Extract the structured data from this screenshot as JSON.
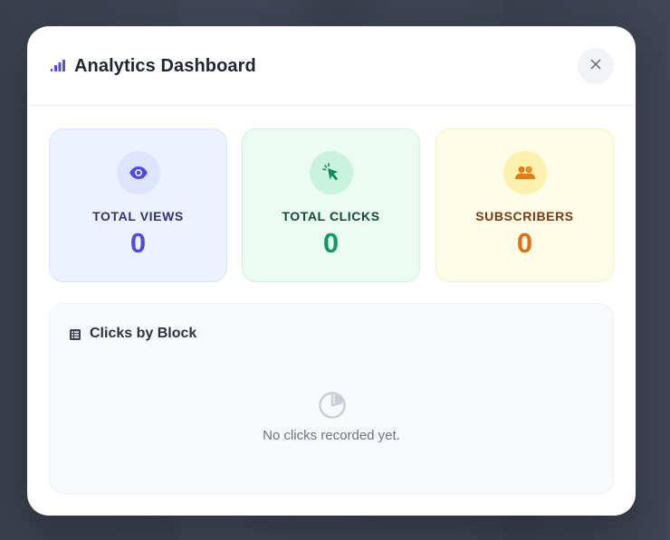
{
  "modal": {
    "title": "Analytics Dashboard",
    "close_icon": "close-icon",
    "title_icon": "bar-chart-icon"
  },
  "stats": {
    "views": {
      "label": "TOTAL VIEWS",
      "value": "0",
      "icon": "eye-icon",
      "accent": "#5349e6"
    },
    "clicks": {
      "label": "TOTAL CLICKS",
      "value": "0",
      "icon": "cursor-click-icon",
      "accent": "#0f9a64"
    },
    "subscribers": {
      "label": "SUBSCRIBERS",
      "value": "0",
      "icon": "users-icon",
      "accent": "#e07010"
    }
  },
  "clicks_by_block": {
    "title": "Clicks by Block",
    "icon": "list-icon",
    "empty_icon": "pie-chart-icon",
    "empty_message": "No clicks recorded yet."
  }
}
